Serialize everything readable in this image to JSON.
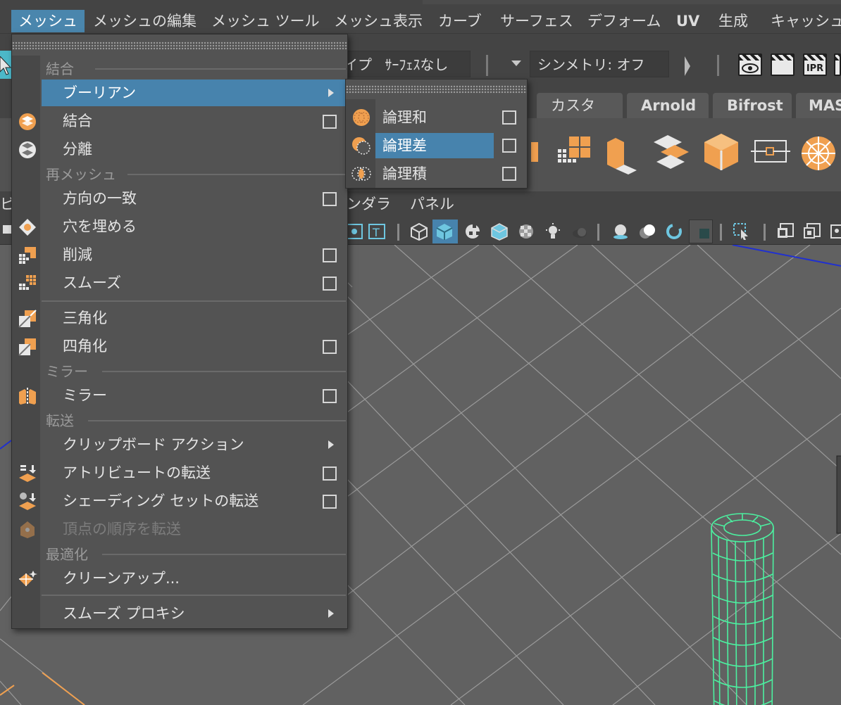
{
  "menubar": {
    "items": [
      {
        "label": "メッシュ",
        "active": true
      },
      {
        "label": "メッシュの編集"
      },
      {
        "label": "メッシュ ツール"
      },
      {
        "label": "メッシュ表示"
      },
      {
        "label": "カーブ"
      },
      {
        "label": "サーフェス"
      },
      {
        "label": "デフォーム"
      },
      {
        "label": "UV"
      },
      {
        "label": "生成"
      },
      {
        "label": "キャッシュ"
      }
    ]
  },
  "statusline": {
    "surface_type_partial": "イプ",
    "surface_value": "ｻｰﾌｪｽなし",
    "symmetry": "シンメトリ: オフ",
    "ipr_label": "IPR"
  },
  "shelf": {
    "tabs": [
      {
        "label": "カスタム"
      },
      {
        "label": "Arnold"
      },
      {
        "label": "Bifrost"
      },
      {
        "label": "MAS"
      }
    ]
  },
  "panel_menu": {
    "items": [
      {
        "label": "ンダラ"
      },
      {
        "label": "パネル"
      }
    ],
    "left_fragment": "ビ"
  },
  "mesh_menu": {
    "sections": {
      "combine": "結合",
      "remesh": "再メッシュ",
      "mirror": "ミラー",
      "transfer": "転送",
      "optimize": "最適化"
    },
    "items": {
      "boolean": "ブーリアン",
      "combine": "結合",
      "separate": "分離",
      "conform": "方向の一致",
      "fill_hole": "穴を埋める",
      "reduce": "削減",
      "smooth": "スムーズ",
      "triangulate": "三角化",
      "quadrangulate": "四角化",
      "mirror": "ミラー",
      "clipboard_actions": "クリップボード アクション",
      "transfer_attributes": "アトリビュートの転送",
      "transfer_shading_sets": "シェーディング セットの転送",
      "transfer_vertex_order": "頂点の順序を転送",
      "cleanup": "クリーンアップ...",
      "smooth_proxy": "スムーズ プロキシ"
    }
  },
  "boolean_submenu": {
    "items": {
      "union": "論理和",
      "difference": "論理差",
      "intersection": "論理積"
    }
  },
  "colors": {
    "highlight": "#4783ad",
    "accent_orange": "#f0a050",
    "viewport_wireframe": "#4cf0a0",
    "axis_blue": "#2030d0"
  }
}
